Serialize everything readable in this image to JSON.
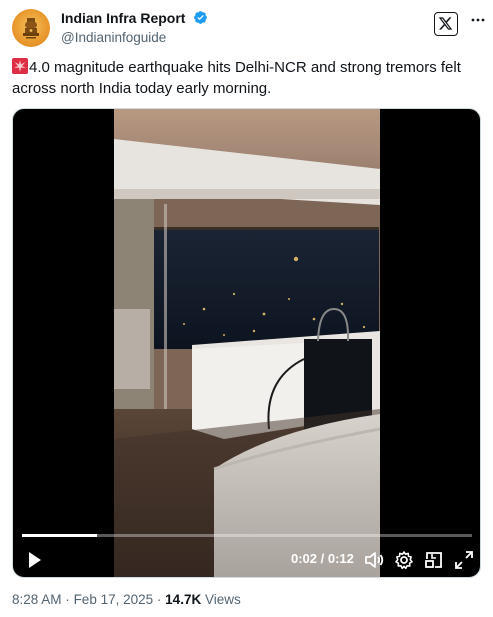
{
  "author": {
    "display_name": "Indian Infra Report",
    "handle": "@Indianinfoguide",
    "verified": true,
    "avatar_icon": "ashoka-emblem-icon"
  },
  "header_icons": {
    "logo": "x-logo-icon",
    "more": "more-options-icon"
  },
  "tweet": {
    "leading_emoji": "rotating-light-emoji",
    "text": "4.0 magnitude earthquake hits Delhi-NCR and strong tremors felt across north India today early morning."
  },
  "video": {
    "current_time": "0:02",
    "duration": "0:12",
    "time_display": "0:02 / 0:12",
    "progress": 0.167,
    "controls": [
      "play-icon",
      "volume-icon",
      "settings-icon",
      "picture-in-picture-icon",
      "fullscreen-icon"
    ]
  },
  "footer": {
    "time": "8:28 AM",
    "separator": "·",
    "date": "Feb 17, 2025",
    "views_count": "14.7K",
    "views_label": "Views"
  },
  "colors": {
    "verified_blue": "#1d9bf0",
    "muted_text": "#536471",
    "text": "#0f1419"
  }
}
